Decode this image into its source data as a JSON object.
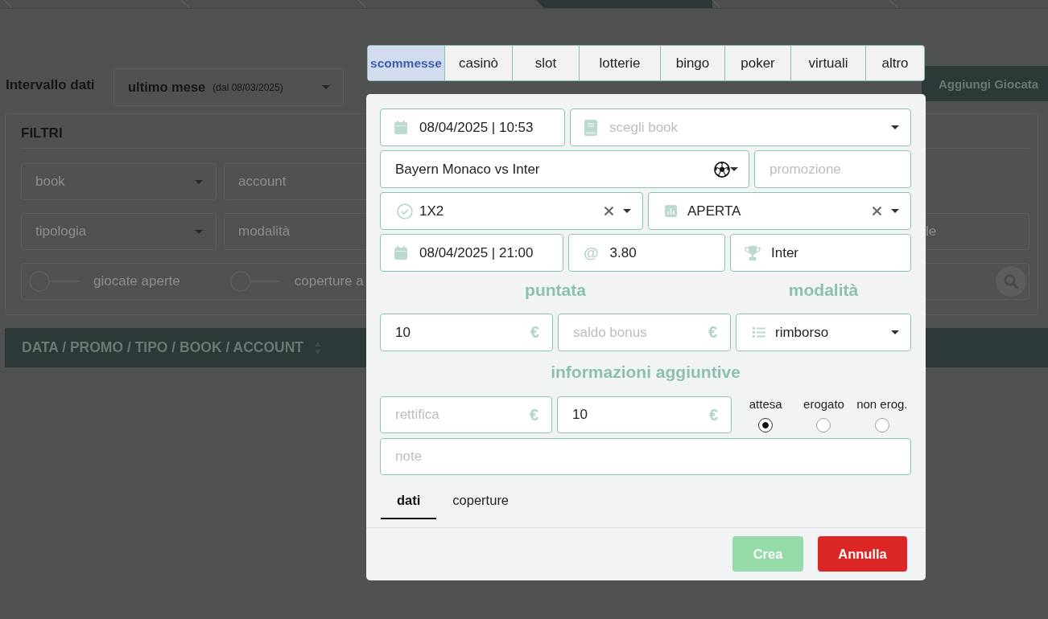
{
  "nav_tabs": [
    {
      "selected": false
    },
    {
      "selected": false
    },
    {
      "selected": false
    },
    {
      "selected": true
    },
    {
      "selected": false
    },
    {
      "selected": false
    }
  ],
  "date_range": {
    "label": "Intervallo dati",
    "value": "ultimo mese",
    "note": "(dal 08/03/2025)"
  },
  "add_button": {
    "label": "Aggiungi Giocata"
  },
  "filters": {
    "title": "FILTRI",
    "rows": [
      {
        "left": [
          {
            "kind": "select",
            "placeholder": "book"
          },
          {
            "kind": "text",
            "placeholder": "account"
          }
        ]
      },
      {
        "left": [
          {
            "kind": "select",
            "placeholder": "tipologia"
          },
          {
            "kind": "text",
            "placeholder": "modalità"
          }
        ],
        "right": [
          {
            "kind": "text",
            "placeholder": "le"
          }
        ]
      }
    ],
    "toggles": [
      {
        "label": "giocate aperte",
        "on": false
      },
      {
        "label": "coperture a",
        "on": false
      }
    ]
  },
  "table": {
    "columns": [
      {
        "label": "DATA / PROMO / TIPO / BOOK / ACCOUNT"
      }
    ]
  },
  "modal": {
    "categories": [
      {
        "label": "scommesse",
        "selected": true
      },
      {
        "label": "casinò",
        "selected": false
      },
      {
        "label": "slot",
        "selected": false
      },
      {
        "label": "lotterie",
        "selected": false
      },
      {
        "label": "bingo",
        "selected": false
      },
      {
        "label": "poker",
        "selected": false
      },
      {
        "label": "virtuali",
        "selected": false
      },
      {
        "label": "altro",
        "selected": false
      }
    ],
    "lines": [
      {
        "fields": [
          {
            "kind": "date",
            "value": "08/04/2025 | 10:53"
          },
          {
            "kind": "book",
            "placeholder": "scegli book"
          }
        ]
      },
      {
        "fields": [
          {
            "kind": "event",
            "value": "Bayern Monaco vs Inter"
          },
          {
            "kind": "text",
            "placeholder": "promozione"
          }
        ]
      },
      {
        "fields": [
          {
            "kind": "market",
            "value": "1X2"
          },
          {
            "kind": "status",
            "value": "APERTA"
          }
        ]
      },
      {
        "fields": [
          {
            "kind": "date",
            "value": "08/04/2025 | 21:00"
          },
          {
            "kind": "odds",
            "prefix": "@",
            "value": "3.80"
          },
          {
            "kind": "pick",
            "value": "Inter"
          }
        ]
      }
    ],
    "stake": {
      "title": "puntata",
      "fields": [
        {
          "kind": "money",
          "value": "10",
          "currency": "€"
        },
        {
          "kind": "money",
          "placeholder": "saldo bonus",
          "currency": "€"
        }
      ]
    },
    "mode": {
      "title": "modalità",
      "field": {
        "kind": "list",
        "value": "rimborso"
      }
    },
    "extra": {
      "title": "informazioni aggiuntive",
      "fields": [
        {
          "kind": "money",
          "placeholder": "rettifica",
          "currency": "€"
        },
        {
          "kind": "money",
          "value": "10",
          "currency": "€"
        }
      ],
      "options": [
        {
          "label": "attesa",
          "selected": true
        },
        {
          "label": "erogato",
          "selected": false
        },
        {
          "label": "non erog.",
          "selected": false
        }
      ]
    },
    "note": {
      "placeholder": "note"
    },
    "tabs": [
      {
        "label": "dati",
        "selected": true
      },
      {
        "label": "coperture",
        "selected": false
      }
    ],
    "buttons": [
      {
        "label": "Crea",
        "kind": "confirm",
        "disabled": true
      },
      {
        "label": "Annulla",
        "kind": "cancel",
        "disabled": false
      }
    ]
  }
}
